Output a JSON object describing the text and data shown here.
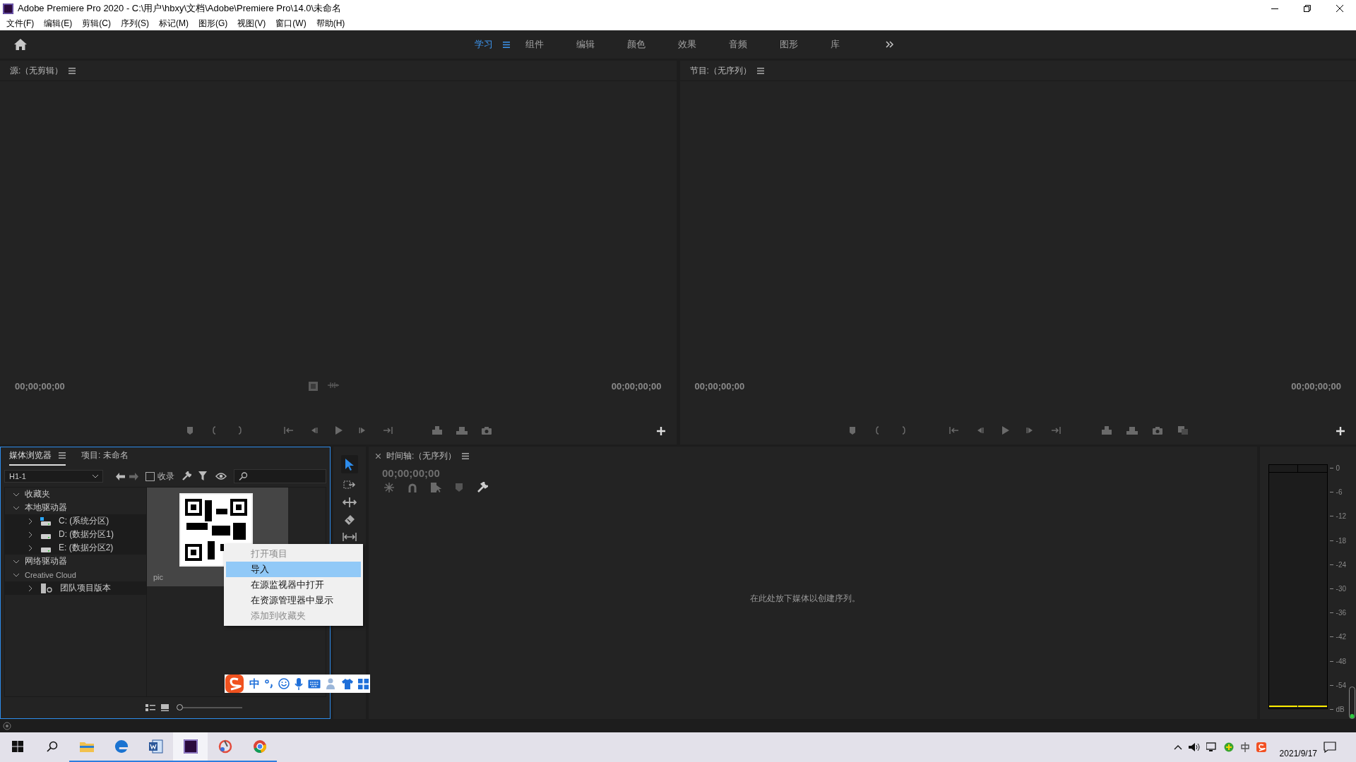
{
  "window": {
    "title": "Adobe Premiere Pro 2020 - C:\\用户\\hbxy\\文档\\Adobe\\Premiere Pro\\14.0\\未命名"
  },
  "menu": [
    "文件(F)",
    "编辑(E)",
    "剪辑(C)",
    "序列(S)",
    "标记(M)",
    "图形(G)",
    "视图(V)",
    "窗口(W)",
    "帮助(H)"
  ],
  "workspaces": [
    {
      "label": "学习",
      "selected": true
    },
    {
      "label": "组件",
      "selected": false
    },
    {
      "label": "编辑",
      "selected": false
    },
    {
      "label": "颜色",
      "selected": false
    },
    {
      "label": "效果",
      "selected": false
    },
    {
      "label": "音频",
      "selected": false
    },
    {
      "label": "图形",
      "selected": false
    },
    {
      "label": "库",
      "selected": false
    }
  ],
  "source_monitor": {
    "title": "源:（无剪辑）",
    "timecode_in": "00;00;00;00",
    "timecode_out": "00;00;00;00"
  },
  "program_monitor": {
    "title": "节目:（无序列）",
    "timecode_in": "00;00;00;00",
    "timecode_out": "00;00;00;00"
  },
  "media_browser": {
    "tabs": [
      {
        "label": "媒体浏览器",
        "selected": true
      },
      {
        "label": "项目: 未命名",
        "selected": false
      }
    ],
    "location": "H1-1",
    "ingest": {
      "label": "收录",
      "checked": false
    },
    "tree": [
      {
        "label": "收藏夹",
        "kind": "group",
        "expanded": true
      },
      {
        "label": "本地驱动器",
        "kind": "group",
        "expanded": true,
        "children": [
          {
            "label": "C: (系统分区)",
            "kind": "system-drive",
            "expanded": false
          },
          {
            "label": "D: (数据分区1)",
            "kind": "drive",
            "expanded": false
          },
          {
            "label": "E: (数据分区2)",
            "kind": "drive",
            "expanded": false
          }
        ]
      },
      {
        "label": "网络驱动器",
        "kind": "group",
        "expanded": true
      },
      {
        "label": "Creative Cloud",
        "kind": "cloud",
        "expanded": true,
        "children": [
          {
            "label": "团队项目版本",
            "kind": "team-project",
            "expanded": false
          }
        ]
      }
    ],
    "items": [
      {
        "name": "pic",
        "kind": "picture"
      }
    ],
    "thumbnail_zoom": {
      "level": 0
    }
  },
  "context_menu": [
    {
      "label": "打开项目",
      "disabled": true,
      "selected": false
    },
    {
      "label": "导入",
      "disabled": false,
      "selected": true
    },
    {
      "label": "在源监视器中打开",
      "disabled": false,
      "selected": false
    },
    {
      "label": "在资源管理器中显示",
      "disabled": false,
      "selected": false
    },
    {
      "label": "添加到收藏夹",
      "disabled": true,
      "selected": false
    }
  ],
  "ime_bar": {
    "mode": "中"
  },
  "timeline": {
    "title": "时间轴:（无序列）",
    "timecode": "00;00;00;00",
    "empty_hint": "在此处放下媒体以创建序列。"
  },
  "audio_meter": {
    "scale": [
      "0",
      "-6",
      "-12",
      "-18",
      "-24",
      "-30",
      "-36",
      "-42",
      "-48",
      "-54",
      "dB"
    ]
  },
  "taskbar": {
    "apps": [
      {
        "kind": "explorer",
        "running": true,
        "selected": false
      },
      {
        "kind": "edge",
        "running": true,
        "selected": false
      },
      {
        "kind": "word",
        "running": true,
        "selected": false
      },
      {
        "kind": "premiere",
        "running": true,
        "selected": true
      },
      {
        "kind": "paint",
        "running": true,
        "selected": false
      },
      {
        "kind": "chrome",
        "running": true,
        "selected": false
      }
    ],
    "date": "2021/9/17"
  }
}
